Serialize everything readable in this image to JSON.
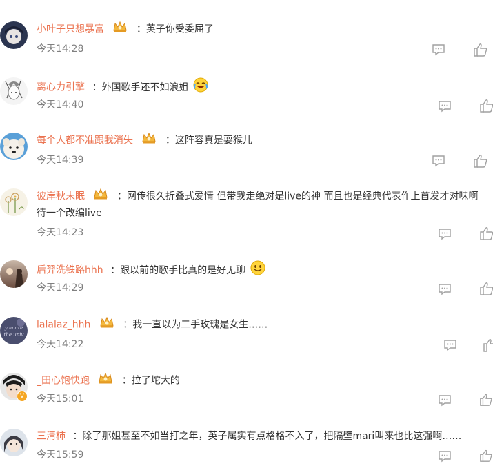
{
  "comments": [
    {
      "username": "小叶子只想暴富",
      "has_crown": true,
      "text": "：英子你受委屈了",
      "time": "今天14:28"
    },
    {
      "username": "离心力引擎",
      "has_crown": false,
      "text": "：外国歌手还不如浪姐",
      "emoji": "laughing-tears-emoji",
      "time": "今天14:40"
    },
    {
      "username": "每个人都不准跟我消失",
      "has_crown": true,
      "text": "：这阵容真是耍猴儿",
      "time": "今天14:39"
    },
    {
      "username": "彼岸秋末眠",
      "has_crown": true,
      "text": "：网传很久折叠式爱情 但带我走绝对是live的神 而且也是经典代表作上首发才对味啊",
      "text_line2": "待一个改编live",
      "time": "今天14:23"
    },
    {
      "username": "后羿洗铁路hhh",
      "has_crown": false,
      "text": "：跟以前的歌手比真的是好无聊",
      "emoji": "smile-emoji",
      "time": "今天14:29"
    },
    {
      "username": "lalalaz_hhh",
      "has_crown": true,
      "text": "：我一直以为二手玫瑰是女生……",
      "time": "今天14:22",
      "avatar_text": [
        "you are",
        "the univ"
      ]
    },
    {
      "username": "_田心饱快跑",
      "has_crown": true,
      "verified": true,
      "verified_mark": "V",
      "text": "：拉了坨大的",
      "time": "今天15:01"
    },
    {
      "username": "三清柿",
      "has_crown": false,
      "text": "：除了那姐甚至不如当打之年，英子属实有点格格不入了，把隔壁mari叫来也比这强啊……",
      "time": "今天15:59"
    }
  ],
  "colors": {
    "username": "#eb7350",
    "text": "#333333",
    "time": "#808080",
    "icon": "#a0a0a0"
  },
  "icons": {
    "reply": "comment-bubble-icon",
    "like": "thumbs-up-icon",
    "crown": "vip-crown-icon"
  }
}
